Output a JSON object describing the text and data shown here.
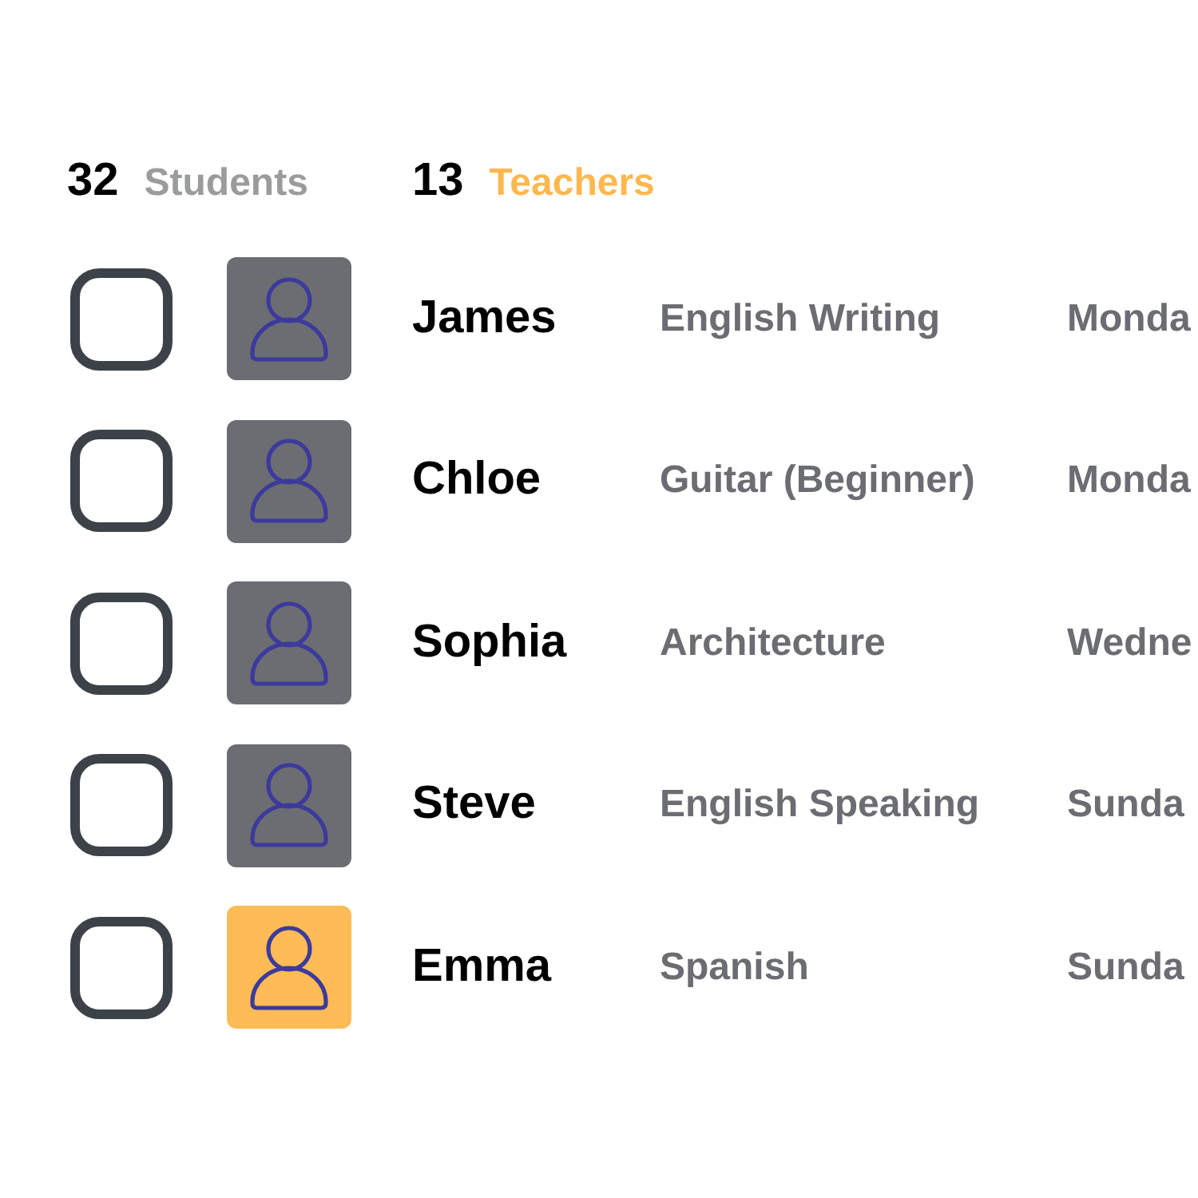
{
  "summary": [
    {
      "count": "32",
      "label": "Students",
      "kind": "student"
    },
    {
      "count": "13",
      "label": "Teachers",
      "kind": "teacher"
    }
  ],
  "rows": [
    {
      "checked": false,
      "kind": "student",
      "name": "James",
      "subject": "English Writing",
      "day": "Monda"
    },
    {
      "checked": false,
      "kind": "student",
      "name": "Chloe",
      "subject": "Guitar (Beginner)",
      "day": "Monda"
    },
    {
      "checked": false,
      "kind": "student",
      "name": "Sophia",
      "subject": "Architecture",
      "day": "Wedne"
    },
    {
      "checked": false,
      "kind": "student",
      "name": "Steve",
      "subject": "English Speaking",
      "day": "Sunda"
    },
    {
      "checked": false,
      "kind": "teacher",
      "name": "Emma",
      "subject": "Spanish",
      "day": "Sunda"
    }
  ]
}
